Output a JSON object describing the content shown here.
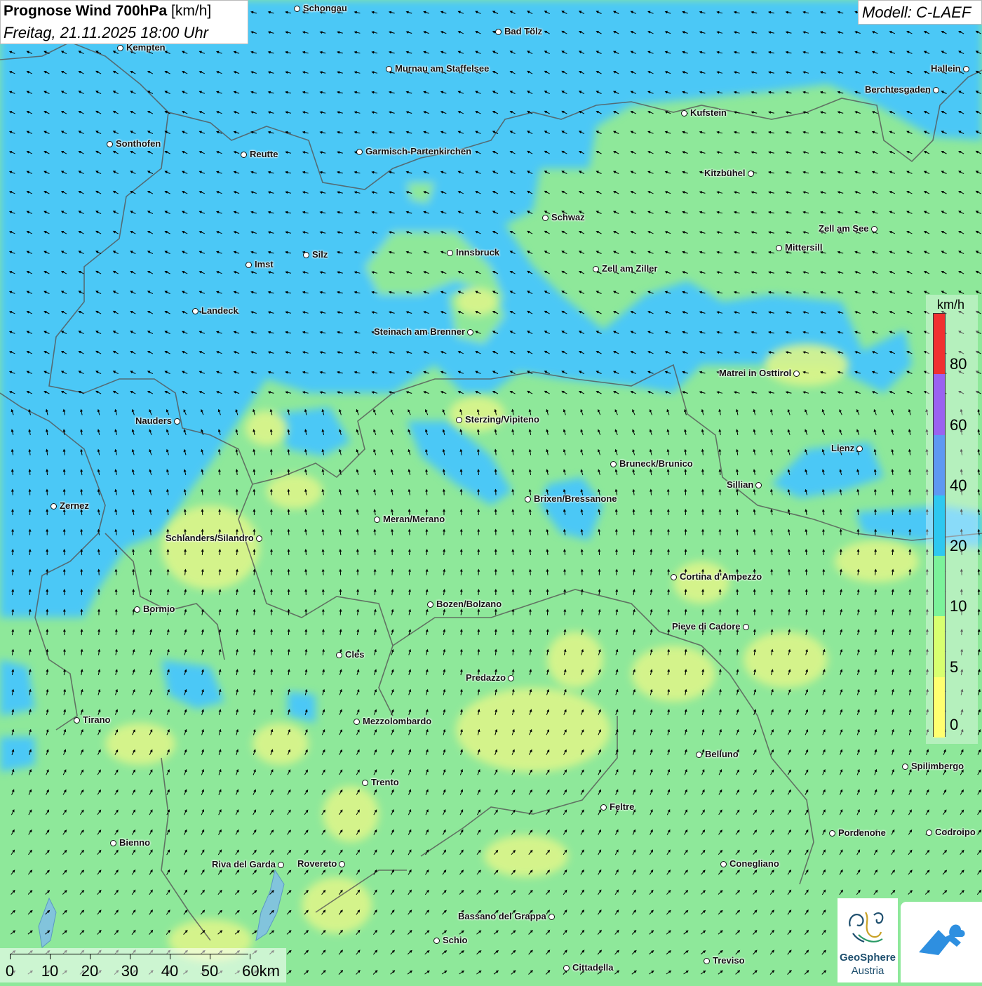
{
  "header": {
    "title_bold": "Prognose Wind 700hPa",
    "title_unit": " [km/h]",
    "subtitle": "Freitag, 21.11.2025 18:00 Uhr",
    "model": "Modell: C-LAEF"
  },
  "legend": {
    "unit": "km/h",
    "bands": [
      {
        "label": "0",
        "color": "#ffff70"
      },
      {
        "label": "5",
        "color": "#d8ff70"
      },
      {
        "label": "10",
        "color": "#7cf29a"
      },
      {
        "label": "20",
        "color": "#2ec8f0"
      },
      {
        "label": "40",
        "color": "#5e98f2"
      },
      {
        "label": "60",
        "color": "#9a62f0"
      },
      {
        "label": "80",
        "color": "#f03030"
      }
    ]
  },
  "scale_bar": [
    "0",
    "10",
    "20",
    "30",
    "40",
    "50",
    "60km"
  ],
  "logos": {
    "geosphere_line1": "GeoSphere",
    "geosphere_line2": "Austria"
  },
  "colors": {
    "blue_zone": "#4cc8f6",
    "green_zone": "#8ee89a",
    "yellow_zone": "#dcf58a",
    "arrow": "#000000",
    "border": "#555555"
  },
  "cities": [
    "Schongau",
    "Bad Tölz",
    "Kempten",
    "Murnau am Staffelsee",
    "Hallein",
    "Berchtesgaden",
    "Kufstein",
    "Sonthofen",
    "Reutte",
    "Garmisch-Partenkirchen",
    "Kitzbühel",
    "Schwaz",
    "Zell am See",
    "Mittersill",
    "Innsbruck",
    "Silz",
    "Imst",
    "Zell am Ziller",
    "Landeck",
    "Steinach am Brenner",
    "Matrei in Osttirol",
    "Nauders",
    "Sterzing/Vipiteno",
    "Lienz",
    "Bruneck/Brunico",
    "Sillian",
    "Zernez",
    "Brixen/Bressanone",
    "Meran/Merano",
    "Schlanders/Silandro",
    "Cortina d'Ampezzo",
    "Bozen/Bolzano",
    "Bormio",
    "Pieve di Cadore",
    "Cles",
    "Predazzo",
    "Tirano",
    "Mezzolombardo",
    "Belluno",
    "Spilimbergo",
    "Trento",
    "Feltre",
    "Pordenone",
    "Codroipo",
    "Bienno",
    "Riva del Garda",
    "Rovereto",
    "Conegliano",
    "Bassano del Grappa",
    "Schio",
    "Treviso",
    "Cittadella"
  ]
}
